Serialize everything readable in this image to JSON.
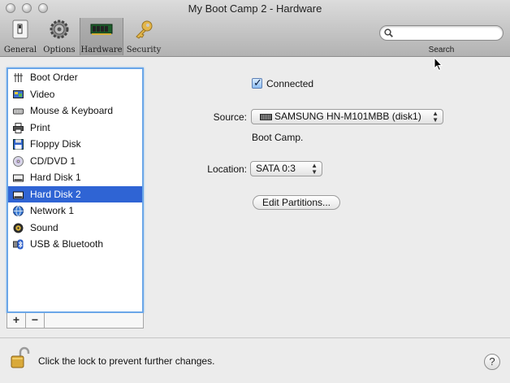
{
  "window": {
    "title": "My Boot Camp 2 - Hardware"
  },
  "toolbar": {
    "items": [
      {
        "label": "General",
        "icon": "switch-icon"
      },
      {
        "label": "Options",
        "icon": "gears-icon"
      },
      {
        "label": "Hardware",
        "icon": "ram-chip-icon",
        "selected": true
      },
      {
        "label": "Security",
        "icon": "key-icon"
      }
    ],
    "search_label": "Search",
    "search_value": ""
  },
  "devices": [
    {
      "label": "Boot Order",
      "icon": "boot-order-icon"
    },
    {
      "label": "Video",
      "icon": "video-icon"
    },
    {
      "label": "Mouse & Keyboard",
      "icon": "keyboard-icon"
    },
    {
      "label": "Print",
      "icon": "printer-icon"
    },
    {
      "label": "Floppy Disk",
      "icon": "floppy-icon"
    },
    {
      "label": "CD/DVD 1",
      "icon": "cd-icon"
    },
    {
      "label": "Hard Disk 1",
      "icon": "hard-disk-icon"
    },
    {
      "label": "Hard Disk 2",
      "icon": "hard-disk-icon",
      "selected": true
    },
    {
      "label": "Network 1",
      "icon": "network-icon"
    },
    {
      "label": "Sound",
      "icon": "sound-icon"
    },
    {
      "label": "USB & Bluetooth",
      "icon": "usb-bluetooth-icon"
    }
  ],
  "list_buttons": {
    "add": "+",
    "remove": "−"
  },
  "detail": {
    "connected_label": "Connected",
    "connected_checked": true,
    "source_label": "Source:",
    "source_value": "SAMSUNG HN-M101MBB (disk1)",
    "info_text": "Boot Camp.",
    "location_label": "Location:",
    "location_value": "SATA 0:3",
    "edit_partitions_label": "Edit Partitions..."
  },
  "footer": {
    "lock_text": "Click the lock to prevent further changes.",
    "help_label": "?"
  },
  "colors": {
    "selection": "#2f64d4",
    "list_focus_ring": "#6aa6e8"
  }
}
